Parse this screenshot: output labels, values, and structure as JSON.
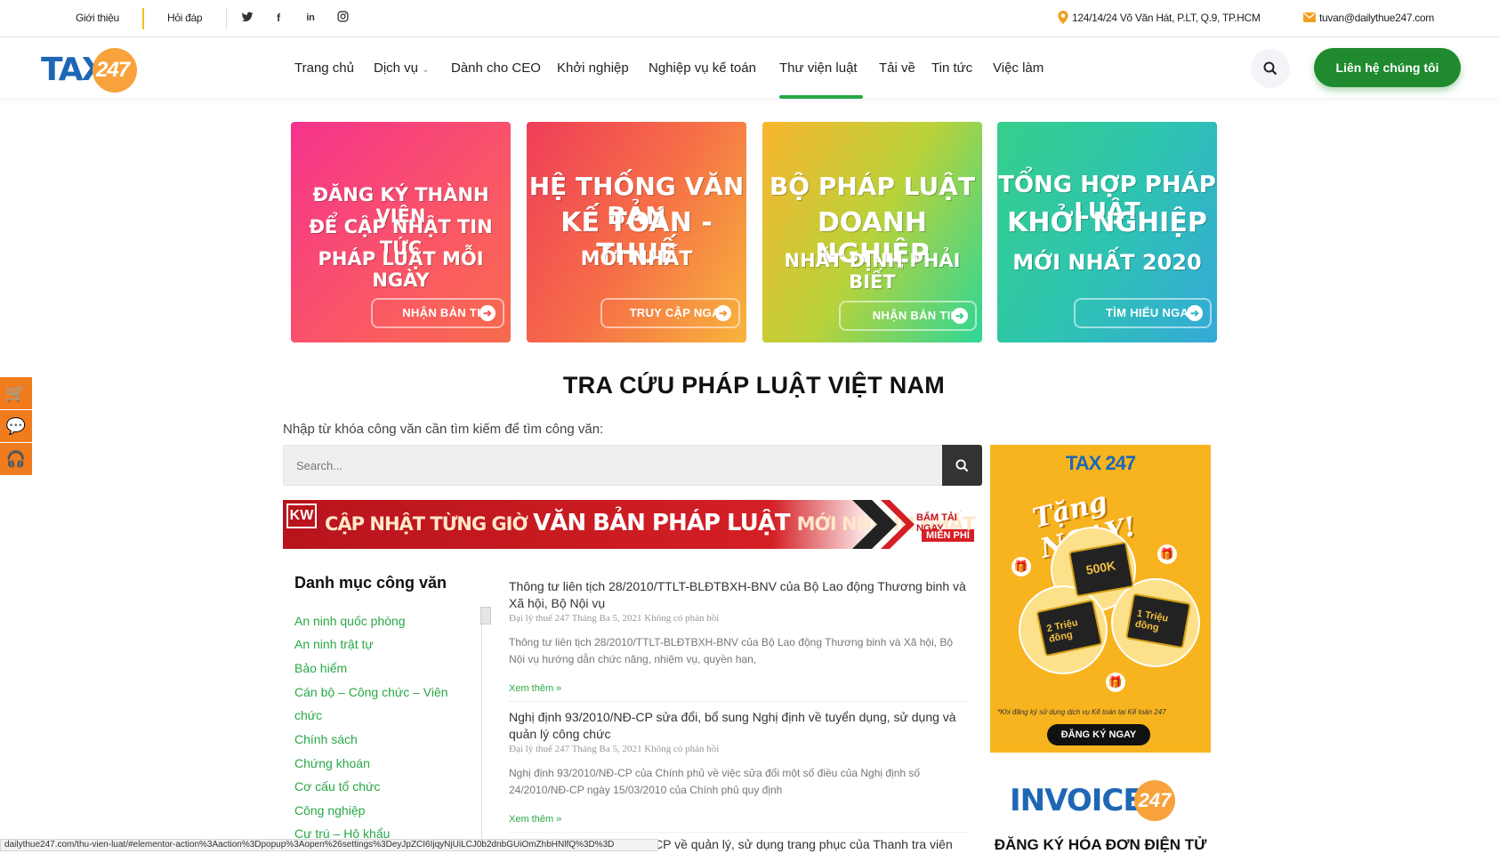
{
  "topbar": {
    "about": "Giới thiệu",
    "faq": "Hỏi đáp",
    "address": "124/14/24 Võ Văn Hát, P.LT, Q.9, TP.HCM",
    "email": "tuvan@dailythue247.com"
  },
  "logo": {
    "text": "TAX",
    "num": "247"
  },
  "nav": {
    "home": "Trang chủ",
    "services": "Dịch vụ",
    "ceo": "Dành cho CEO",
    "startup": "Khởi nghiệp",
    "accounting": "Nghiệp vụ kế toán",
    "library": "Thư viện luật",
    "download": "Tải về",
    "news": "Tin tức",
    "jobs": "Việc làm",
    "contact": "Liên hệ chúng tôi"
  },
  "banners": [
    {
      "l1": "ĐĂNG KÝ THÀNH VIÊN",
      "l2": "ĐỂ CẬP NHẬT TIN TỨC",
      "l3": "PHÁP LUẬT MỖI NGÀY",
      "cta": "NHẬN BẢN TIN"
    },
    {
      "l1": "HỆ THỐNG VĂN BẢN",
      "l2": "KẾ TOÁN - THUẾ",
      "l3": "MỚI NHẤT",
      "cta": "TRUY CẬP NGAY"
    },
    {
      "l1": "BỘ PHÁP LUẬT",
      "l2": "DOANH NGHIỆP",
      "l3": "NHẤT ĐỊNH PHẢI BIẾT",
      "cta": "NHẬN BẢN TIN"
    },
    {
      "l1": "TỔNG HỢP PHÁP LUẬT",
      "l2": "KHỞI NGHIỆP",
      "l3": "MỚI NHẤT 2020",
      "cta": "TÌM HIỂU NGAY"
    }
  ],
  "main": {
    "title": "TRA CỨU PHÁP LUẬT VIỆT NAM",
    "prompt": "Nhập từ khóa công văn cần tìm kiếm để tìm công văn:",
    "search_placeholder": "Search..."
  },
  "red_banner": {
    "kw": "KW",
    "text_a": "CẬP NHẬT TỪNG GIỜ ",
    "text_b": "VĂN BẢN PHÁP LUẬT ",
    "text_c": "MỚI NHANH NHẤT",
    "free_top": "BẤM TẢI NGAY",
    "free_bottom": "MIỄN PHÍ"
  },
  "categories": {
    "title": "Danh mục công văn",
    "items": [
      "An ninh quốc phòng",
      "An ninh trật tự",
      "Bảo hiểm",
      "Cán bộ – Công chức – Viên",
      "chức",
      "Chính sách",
      "Chứng khoán",
      "Cơ cấu tổ chức",
      "Công nghiệp",
      "Cư trú – Hộ khẩu"
    ]
  },
  "posts": [
    {
      "title": "Thông tư liên tịch 28/2010/TTLT-BLĐTBXH-BNV của Bộ Lao động Thương binh và Xã hội, Bộ Nội vụ",
      "meta": "Đại lý thuế 247 Tháng Ba 5, 2021 Không có phản hồi",
      "excerpt": "Thông tư liên tịch 28/2010/TTLT-BLĐTBXH-BNV của Bộ Lao động Thương binh và Xã hội, Bộ Nội vụ hướng dẫn chức năng, nhiệm vụ, quyền hạn,",
      "more": "Xem thêm »"
    },
    {
      "title": "Nghị định 93/2010/NĐ-CP sửa đổi, bổ sung Nghị định về tuyển dụng, sử dụng và quản lý công chức",
      "meta": "Đại lý thuế 247 Tháng Ba 5, 2021 Không có phản hồi",
      "excerpt": "Nghị định 93/2010/NĐ-CP của Chính phủ về việc sửa đổi một số điều của Nghị định số 24/2010/NĐ-CP ngày 15/03/2010 của Chính phủ quy định",
      "more": "Xem thêm »"
    }
  ],
  "cut_post": "CP về quản lý, sử dụng trang phục của Thanh tra viên",
  "ad": {
    "brand": "TAX 247",
    "headline": "Tặng NGAY!",
    "card1": "500K",
    "card2": "2 Triệu đồng",
    "card3": "1 Triệu đồng",
    "note": "*Khi đăng ký sử dụng dịch vụ Kế toán tại Kế toán 247",
    "cta": "ĐĂNG KÝ NGAY"
  },
  "invoice": {
    "word": "INVOICE",
    "num": "247",
    "sub": "ĐĂNG KÝ HÓA ĐƠN ĐIỆN TỬ"
  },
  "status_url": "dailythue247.com/thu-vien-luat/#elementor-action%3Aaction%3Dpopup%3Aopen%26settings%3DeyJpZCI6IjqyNjUiLCJ0b2dnbGUiOmZhbHNlfQ%3D%3D"
}
